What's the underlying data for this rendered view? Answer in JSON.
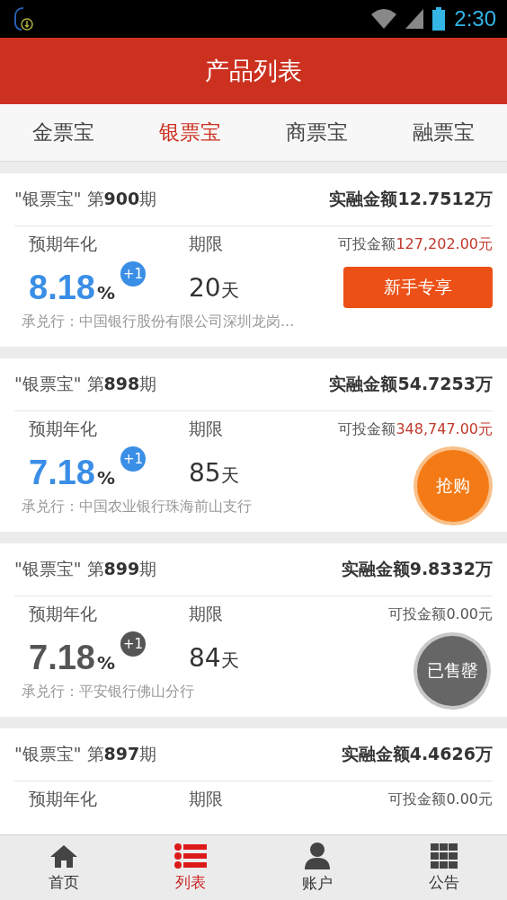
{
  "status_bar": {
    "time": "2:30"
  },
  "header": {
    "title": "产品列表"
  },
  "tabs": [
    {
      "label": "金票宝",
      "selected": false
    },
    {
      "label": "银票宝",
      "selected": true
    },
    {
      "label": "商票宝",
      "selected": false
    },
    {
      "label": "融票宝",
      "selected": false
    }
  ],
  "products": [
    {
      "name": "\"银票宝\" 第**900**期",
      "financed_label": "实融金额",
      "financed": "12.7512万",
      "rate_label": "预期年化",
      "term_label": "期限",
      "available_label": "可投金额",
      "available": "127,202.00元",
      "sold_out": false,
      "rate": "8.18",
      "rate_unit": "%",
      "bonus": "+1",
      "term": "20",
      "term_unit": "天",
      "action": {
        "kind": "newbie",
        "label": "新手专享"
      },
      "issuer": "承兑行：中国银行股份有限公司深圳龙岗..."
    },
    {
      "name": "\"银票宝\" 第**898**期",
      "financed_label": "实融金额",
      "financed": "54.7253万",
      "rate_label": "预期年化",
      "term_label": "期限",
      "available_label": "可投金额",
      "available": "348,747.00元",
      "sold_out": false,
      "rate": "7.18",
      "rate_unit": "%",
      "bonus": "+1",
      "term": "85",
      "term_unit": "天",
      "action": {
        "kind": "buy",
        "label": "抢购"
      },
      "issuer": "承兑行：中国农业银行珠海前山支行"
    },
    {
      "name": "\"银票宝\" 第**899**期",
      "financed_label": "实融金额",
      "financed": "9.8332万",
      "rate_label": "预期年化",
      "term_label": "期限",
      "available_label": "可投金额",
      "available": "0.00元",
      "sold_out": true,
      "rate": "7.18",
      "rate_unit": "%",
      "bonus": "+1",
      "term": "84",
      "term_unit": "天",
      "action": {
        "kind": "sold",
        "label": "已售罄"
      },
      "issuer": "承兑行：平安银行佛山分行"
    },
    {
      "name": "\"银票宝\" 第**897**期",
      "financed_label": "实融金额",
      "financed": "4.4626万",
      "rate_label": "预期年化",
      "term_label": "期限",
      "available_label": "可投金额",
      "available": "0.00元",
      "sold_out": true
    }
  ],
  "nav": [
    {
      "kind": "home",
      "label": "首页",
      "selected": false
    },
    {
      "kind": "list",
      "label": "列表",
      "selected": true
    },
    {
      "kind": "account",
      "label": "账户",
      "selected": false
    },
    {
      "kind": "notice",
      "label": "公告",
      "selected": false
    }
  ]
}
